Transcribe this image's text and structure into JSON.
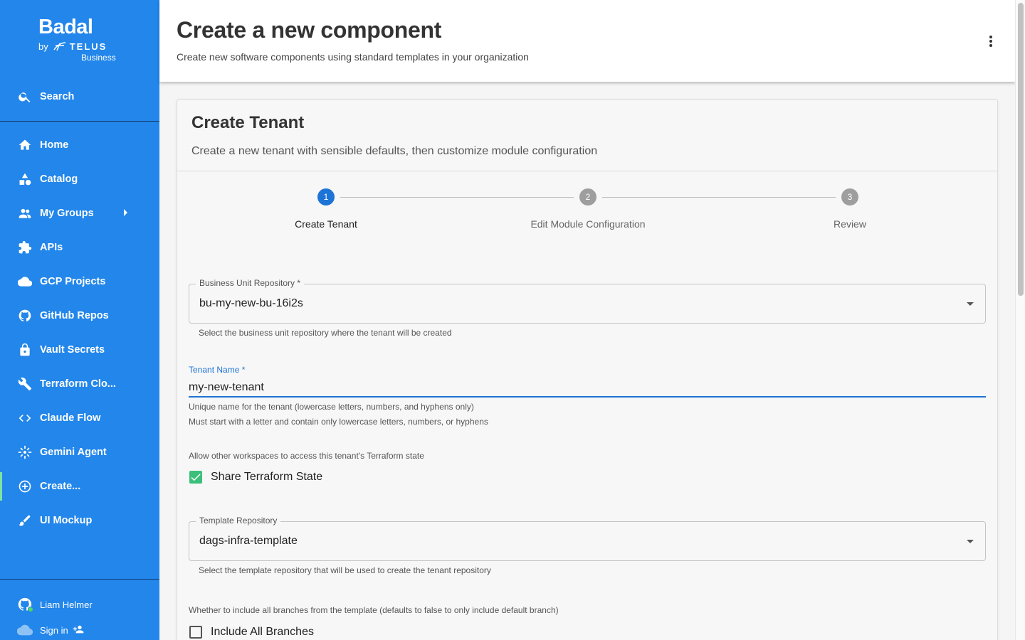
{
  "sidebar": {
    "logo": {
      "brand": "Badal",
      "by": "by",
      "telus": "TELUS",
      "business": "Business"
    },
    "search_label": "Search",
    "items": [
      {
        "label": "Home",
        "icon": "home-icon"
      },
      {
        "label": "Catalog",
        "icon": "shapes-icon"
      },
      {
        "label": "My Groups",
        "icon": "groups-icon"
      },
      {
        "label": "APIs",
        "icon": "puzzle-icon"
      },
      {
        "label": "GCP Projects",
        "icon": "cloud-icon"
      },
      {
        "label": "GitHub Repos",
        "icon": "github-icon"
      },
      {
        "label": "Vault Secrets",
        "icon": "lock-icon"
      },
      {
        "label": "Terraform Clo...",
        "icon": "wrench-icon"
      },
      {
        "label": "Claude Flow",
        "icon": "code-icon"
      },
      {
        "label": "Gemini Agent",
        "icon": "sparkle-icon"
      },
      {
        "label": "Create...",
        "icon": "add-circle-icon"
      },
      {
        "label": "UI Mockup",
        "icon": "brush-icon"
      }
    ],
    "user": {
      "name": "Liam Helmer",
      "signin": "Sign in"
    }
  },
  "header": {
    "title": "Create a new component",
    "subtitle": "Create new software components using standard templates in your organization"
  },
  "card": {
    "title": "Create Tenant",
    "subtitle": "Create a new tenant with sensible defaults, then customize module configuration"
  },
  "stepper": {
    "steps": [
      {
        "number": "1",
        "label": "Create Tenant",
        "state": "active"
      },
      {
        "number": "2",
        "label": "Edit Module Configuration",
        "state": "pending"
      },
      {
        "number": "3",
        "label": "Review",
        "state": "pending"
      }
    ]
  },
  "form": {
    "bu_repo": {
      "label": "Business Unit Repository *",
      "value": "bu-my-new-bu-16i2s",
      "helper": "Select the business unit repository where the tenant will be created"
    },
    "tenant_name": {
      "label": "Tenant Name *",
      "value": "my-new-tenant",
      "helper1": "Unique name for the tenant (lowercase letters, numbers, and hyphens only)",
      "helper2": "Must start with a letter and contain only lowercase letters, numbers, or hyphens"
    },
    "share_state": {
      "description": "Allow other workspaces to access this tenant's Terraform state",
      "label": "Share Terraform State",
      "checked": true
    },
    "template_repo": {
      "label": "Template Repository",
      "value": "dags-infra-template",
      "helper": "Select the template repository that will be used to create the tenant repository"
    },
    "include_branches": {
      "description": "Whether to include all branches from the template (defaults to false to only include default branch)",
      "label": "Include All Branches",
      "checked": false
    }
  },
  "colors": {
    "sidebar_bg": "#2286ea",
    "active_indicator": "#7ee3a5",
    "primary": "#1e73d6",
    "checkbox_checked": "#3bbf7a"
  }
}
